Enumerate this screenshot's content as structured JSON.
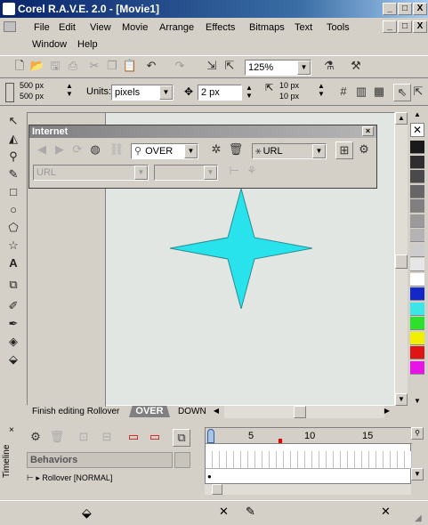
{
  "window": {
    "title": "Corel R.A.V.E. 2.0 - [Movie1]",
    "caption_buttons": [
      "_",
      "□",
      "X"
    ],
    "mdi_buttons": [
      "_",
      "□",
      "X"
    ]
  },
  "menu": {
    "row1": [
      "File",
      "Edit",
      "View",
      "Movie",
      "Arrange",
      "Effects",
      "Bitmaps",
      "Text",
      "Tools"
    ],
    "row2": [
      "Window",
      "Help"
    ]
  },
  "toolbar": {
    "zoom_value": "125%"
  },
  "property_bar": {
    "width_value": "500 px",
    "height_value": "500 px",
    "units_label": "Units:",
    "units_value": "pixels",
    "nudge_value": "2 px",
    "dup_x_value": "10 px",
    "dup_y_value": "10 px"
  },
  "internet_toolbar": {
    "title": "Internet",
    "state_value": "OVER",
    "url_value": "URL",
    "url_field_placeholder": "URL",
    "target_value": ""
  },
  "page_tabs": {
    "finish": "Finish editing Rollover",
    "over": "OVER",
    "down": "DOWN"
  },
  "timeline": {
    "label": "Timeline",
    "behaviors_label": "Behaviors",
    "frame_marks": [
      "5",
      "10",
      "15"
    ],
    "row_label": "Rollover [NORMAL]"
  },
  "colors": {
    "star_fill": "#29e3ec",
    "palette": [
      "#ffffff",
      "#1a1a1a",
      "#2e2e2e",
      "#4a4a4a",
      "#666666",
      "#808080",
      "#9a9a9a",
      "#b3b3b3",
      "#cccccc",
      "#e6e6e6",
      "#ffffff",
      "#1428c8",
      "#3de6e6",
      "#2ee02e",
      "#f0f000",
      "#e01414",
      "#e614e6"
    ]
  },
  "icons": {
    "tools": [
      "pick-tool-icon",
      "shape-tool-icon",
      "zoom-tool-icon",
      "freehand-tool-icon",
      "rectangle-tool-icon",
      "ellipse-tool-icon",
      "polygon-tool-icon",
      "star-tool-icon",
      "text-tool-icon",
      "interactive-tool-icon",
      "eyedropper-tool-icon",
      "outline-tool-icon",
      "fill-tool-icon",
      "interactive-fill-icon"
    ]
  }
}
